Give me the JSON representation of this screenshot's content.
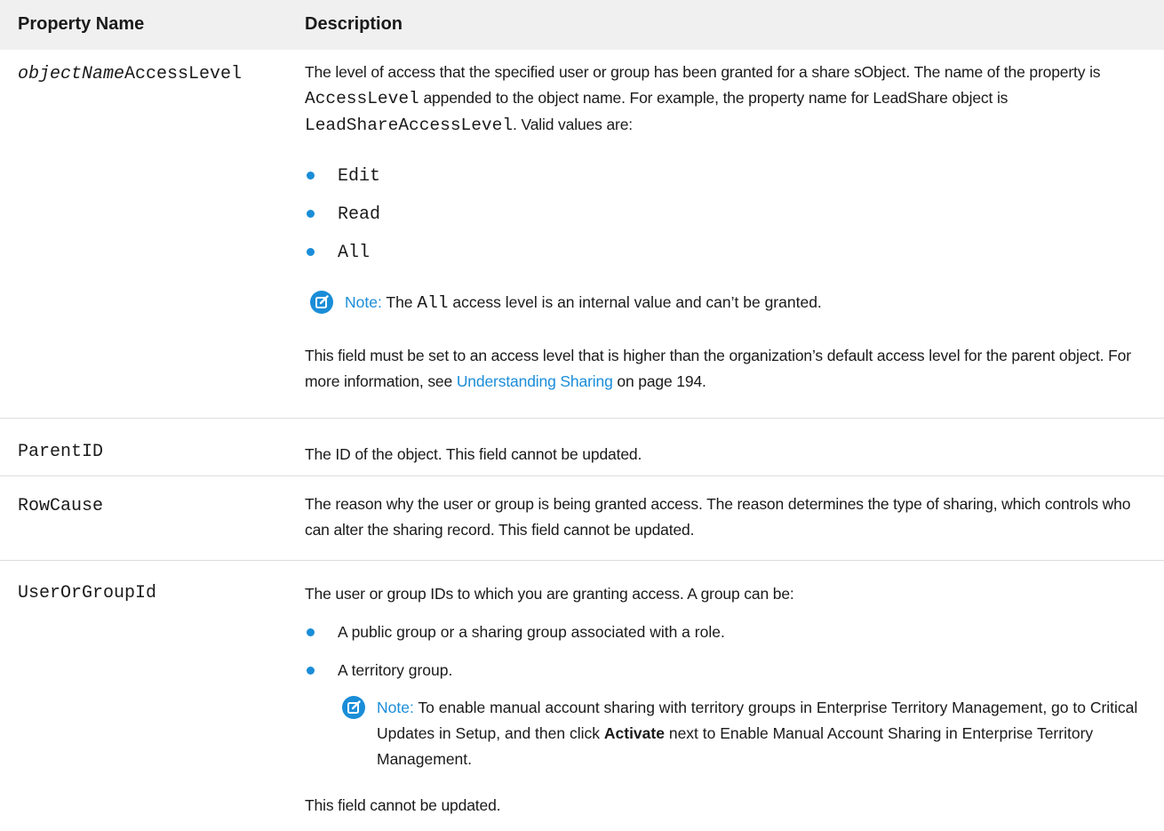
{
  "header": {
    "property_name": "Property Name",
    "description": "Description"
  },
  "rows": [
    {
      "prop_italic": "objectName",
      "prop_suffix": "AccessLevel",
      "desc": {
        "p1_a": "The level of access that the specified user or group has been granted for a share sObject. The name of the property is",
        "p1_code1": "AccessLevel",
        "p1_b": "appended to the object name. For example, the property name for LeadShare object is",
        "p1_code2": "LeadShareAccessLevel",
        "p1_c": ". Valid values are:",
        "values": [
          "Edit",
          "Read",
          "All"
        ],
        "note_label": "Note:",
        "note_a": "The",
        "note_code": "All",
        "note_b": "access level is an internal value and can’t be granted.",
        "p2_a": "This field must be set to an access level that is higher than the organization’s default access level for the parent object. For more information, see",
        "p2_link": "Understanding Sharing",
        "p2_b": "on page 194."
      }
    },
    {
      "prop": "ParentID",
      "desc": "The ID of the object. This field cannot be updated."
    },
    {
      "prop": "RowCause",
      "desc": "The reason why the user or group is being granted access. The reason determines the type of sharing, which controls who can alter the sharing record. This field cannot be updated."
    },
    {
      "prop": "UserOrGroupId",
      "desc": {
        "p1": "The user or group IDs to which you are granting access. A group can be:",
        "items": [
          "A public group or a sharing group associated with a role.",
          "A territory group."
        ],
        "note_label": "Note:",
        "note_a": "To enable manual account sharing with territory groups in Enterprise Territory Management, go to Critical Updates in Setup, and then click",
        "note_bold": "Activate",
        "note_b": "next to Enable Manual Account Sharing in Enterprise Territory Management.",
        "p2": "This field cannot be updated."
      }
    }
  ],
  "colors": {
    "accent": "#1a8dd8",
    "header_bg": "#f0f0f0",
    "divider": "#dcdcdc"
  },
  "icons": {
    "note": "edit-note-icon",
    "bullet": "bullet-dot"
  }
}
